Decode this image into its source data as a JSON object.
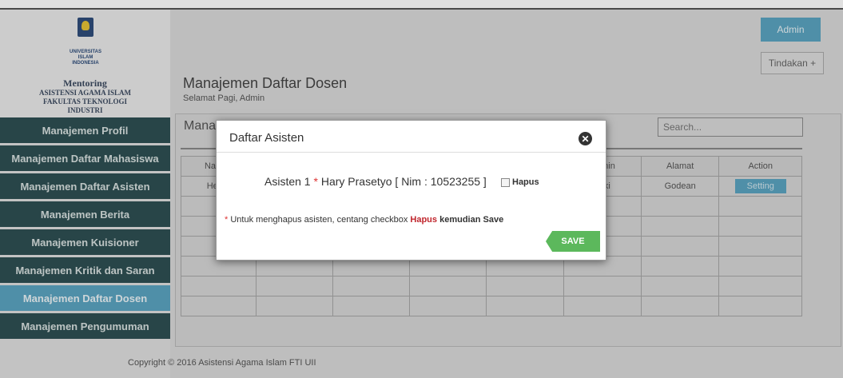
{
  "brand": {
    "logo_lines": [
      "UNIVERSITAS",
      "ISLAM",
      "INDONESIA"
    ],
    "title": "Mentoring",
    "subtitle_1": "ASISTENSI AGAMA ISLAM",
    "subtitle_2": "FAKULTAS TEKNOLOGI",
    "subtitle_3": "INDUSTRI"
  },
  "sidebar": {
    "items": [
      {
        "label": "Manajemen Profil"
      },
      {
        "label": "Manajemen Daftar Mahasiswa"
      },
      {
        "label": "Manajemen Daftar Asisten"
      },
      {
        "label": "Manajemen Berita"
      },
      {
        "label": "Manajemen Kuisioner"
      },
      {
        "label": "Manajemen Kritik dan Saran"
      },
      {
        "label": "Manajemen Daftar Dosen",
        "active": true
      },
      {
        "label": "Manajemen Pengumuman"
      }
    ]
  },
  "header": {
    "admin_label": "Admin",
    "tindakan_label": "Tindakan +",
    "page_title": "Manajemen Daftar Dosen",
    "greeting": "Selamat Pagi, Admin"
  },
  "panel": {
    "title": "Mana",
    "search_placeholder": "Search...",
    "columns": [
      "Nama I",
      "",
      "",
      "",
      "",
      "elamin",
      "Alamat",
      "Action"
    ],
    "rows": [
      [
        "Hendr",
        "",
        "",
        "",
        "",
        "-laki",
        "Godean",
        "Setting"
      ],
      [
        "",
        "",
        "",
        "",
        "",
        "",
        "",
        ""
      ],
      [
        "",
        "",
        "",
        "",
        "",
        "",
        "",
        ""
      ],
      [
        "",
        "",
        "",
        "",
        "",
        "",
        "",
        ""
      ],
      [
        "",
        "",
        "",
        "",
        "",
        "",
        "",
        ""
      ],
      [
        "",
        "",
        "",
        "",
        "",
        "",
        "",
        ""
      ],
      [
        "",
        "",
        "",
        "",
        "",
        "",
        "",
        ""
      ]
    ]
  },
  "footer": {
    "text": "Copyright © 2016 Asistensi Agama Islam FTI UII"
  },
  "modal": {
    "title": "Daftar Asisten",
    "close_icon": "close-icon",
    "asisten_label": "Asisten 1",
    "asisten_value": "Hary Prasetyo [ Nim : 10523255 ]",
    "hapus_label": "Hapus",
    "note_prefix": "Untuk menghapus asisten, centang checkbox",
    "note_hapus": "Hapus",
    "note_mid": "kemudian",
    "note_save": "Save",
    "save_label": "SAVE"
  },
  "colors": {
    "accent": "#5aa3c0",
    "sidebar_item": "#2e4f52",
    "save": "#5cb85c",
    "required": "#d33"
  }
}
